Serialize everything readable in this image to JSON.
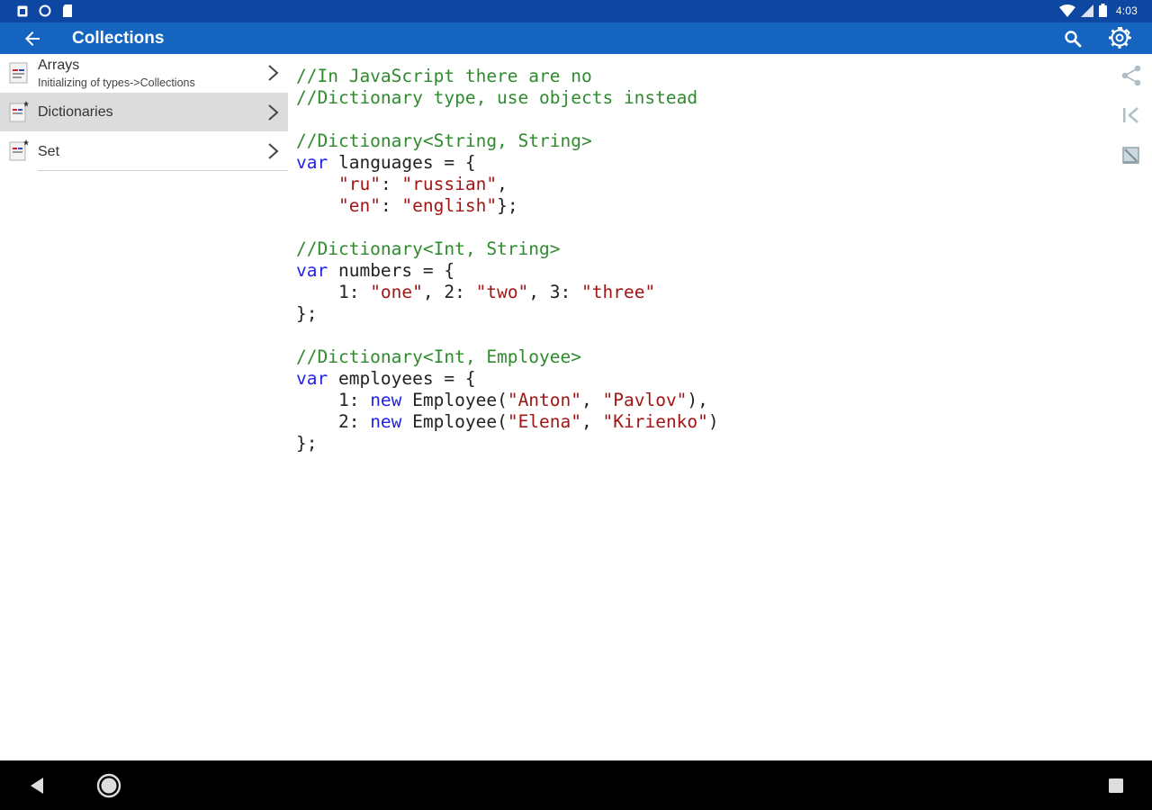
{
  "status_bar": {
    "time": "4:03"
  },
  "app_bar": {
    "title": "Collections",
    "accent": "#1565c0",
    "status_color": "#0d47a1"
  },
  "sidebar": {
    "items": [
      {
        "title": "Arrays",
        "subtitle": "Initializing of types->Collections"
      },
      {
        "title": "Dictionaries",
        "subtitle": ""
      },
      {
        "title": "Set",
        "subtitle": ""
      }
    ]
  },
  "code": {
    "lines": [
      [
        {
          "t": "//In JavaScript there are no",
          "c": "com"
        }
      ],
      [
        {
          "t": "//Dictionary type, use objects instead",
          "c": "com"
        }
      ],
      [],
      [
        {
          "t": "//Dictionary<String, String>",
          "c": "com"
        }
      ],
      [
        {
          "t": "var",
          "c": "kw"
        },
        {
          "t": " languages = {",
          "c": ""
        }
      ],
      [
        {
          "t": "    ",
          "c": ""
        },
        {
          "t": "\"ru\"",
          "c": "str"
        },
        {
          "t": ": ",
          "c": ""
        },
        {
          "t": "\"russian\"",
          "c": "str"
        },
        {
          "t": ",",
          "c": ""
        }
      ],
      [
        {
          "t": "    ",
          "c": ""
        },
        {
          "t": "\"en\"",
          "c": "str"
        },
        {
          "t": ": ",
          "c": ""
        },
        {
          "t": "\"english\"",
          "c": "str"
        },
        {
          "t": "};",
          "c": ""
        }
      ],
      [],
      [
        {
          "t": "//Dictionary<Int, String>",
          "c": "com"
        }
      ],
      [
        {
          "t": "var",
          "c": "kw"
        },
        {
          "t": " numbers = {",
          "c": ""
        }
      ],
      [
        {
          "t": "    1: ",
          "c": ""
        },
        {
          "t": "\"one\"",
          "c": "str"
        },
        {
          "t": ", 2: ",
          "c": ""
        },
        {
          "t": "\"two\"",
          "c": "str"
        },
        {
          "t": ", 3: ",
          "c": ""
        },
        {
          "t": "\"three\"",
          "c": "str"
        }
      ],
      [
        {
          "t": "};",
          "c": ""
        }
      ],
      [],
      [
        {
          "t": "//Dictionary<Int, Employee>",
          "c": "com"
        }
      ],
      [
        {
          "t": "var",
          "c": "kw"
        },
        {
          "t": " employees = {",
          "c": ""
        }
      ],
      [
        {
          "t": "    1: ",
          "c": ""
        },
        {
          "t": "new",
          "c": "kw"
        },
        {
          "t": " Employee(",
          "c": ""
        },
        {
          "t": "\"Anton\"",
          "c": "str"
        },
        {
          "t": ", ",
          "c": ""
        },
        {
          "t": "\"Pavlov\"",
          "c": "str"
        },
        {
          "t": "),",
          "c": ""
        }
      ],
      [
        {
          "t": "    2: ",
          "c": ""
        },
        {
          "t": "new",
          "c": "kw"
        },
        {
          "t": " Employee(",
          "c": ""
        },
        {
          "t": "\"Elena\"",
          "c": "str"
        },
        {
          "t": ", ",
          "c": ""
        },
        {
          "t": "\"Kirienko\"",
          "c": "str"
        },
        {
          "t": ")",
          "c": ""
        }
      ],
      [
        {
          "t": "};",
          "c": ""
        }
      ]
    ],
    "colors": {
      "comment": "#2e8b2e",
      "keyword": "#2323e6",
      "string": "#a31515"
    }
  },
  "actions": {
    "icons": [
      "share-icon",
      "skip-previous-icon",
      "mark-icon"
    ]
  },
  "nav_bar": {
    "icons": [
      "back-icon",
      "home-icon",
      "recents-icon"
    ]
  }
}
